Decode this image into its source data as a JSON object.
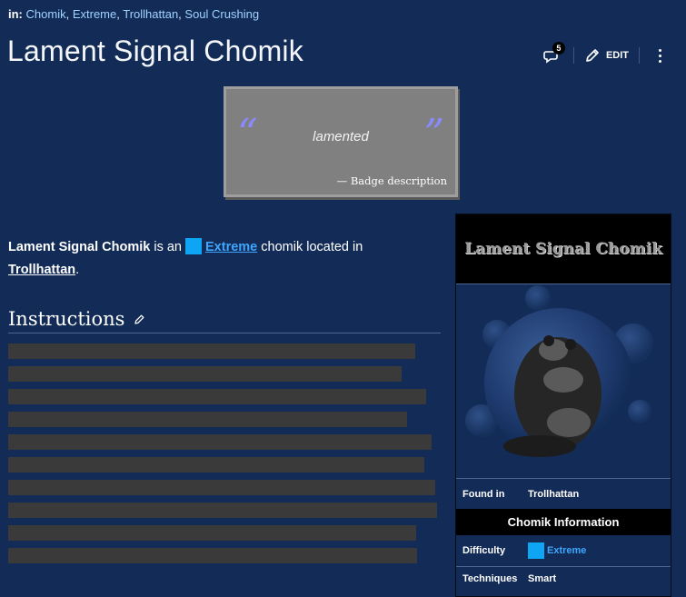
{
  "categories": {
    "prefix": "in:",
    "items": [
      "Chomik",
      "Extreme",
      "Trollhattan",
      "Soul Crushing"
    ]
  },
  "page": {
    "title": "Lament Signal Chomik"
  },
  "actions": {
    "comment_count": "5",
    "edit_label": "EDIT"
  },
  "quote": {
    "open_mark": "“",
    "close_mark": "”",
    "text": "lamented",
    "cite": "— Badge description"
  },
  "intro": {
    "name": "Lament Signal Chomik",
    "text_1": " is an ",
    "difficulty_link": "Extreme",
    "text_2": " chomik located in ",
    "location_link": "Trollhattan",
    "text_3": "."
  },
  "instructions": {
    "heading": "Instructions"
  },
  "infobox": {
    "title": "Lament Signal Chomik",
    "found_in_label": "Found in",
    "found_in_value": "Trollhattan",
    "section_label": "Chomik Information",
    "difficulty_label": "Difficulty",
    "difficulty_value": "Extreme",
    "techniques_label": "Techniques",
    "techniques_value": "Smart"
  },
  "colors": {
    "background": "#132c57",
    "extreme": "#0ea5f5",
    "link_accent": "#3ea6ff",
    "redacted_bar": "#3a3a3a",
    "quote_box": "#808080"
  },
  "icons": [
    "comment-icon",
    "pencil-icon",
    "more-vertical-icon",
    "edit-section-pencil-icon"
  ]
}
